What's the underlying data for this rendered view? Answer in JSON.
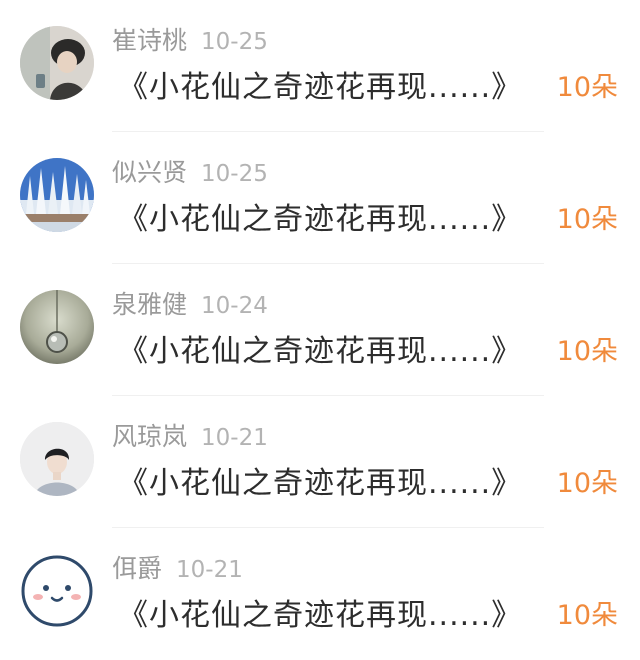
{
  "items": [
    {
      "user": "崔诗桃",
      "date": "10-25",
      "title": "《小花仙之奇迹花再现......》",
      "count": "10朵",
      "avatar": "avatar-girl-hat-icon"
    },
    {
      "user": "似兴贤",
      "date": "10-25",
      "title": "《小花仙之奇迹花再现......》",
      "count": "10朵",
      "avatar": "avatar-snow-trees-icon"
    },
    {
      "user": "泉雅健",
      "date": "10-24",
      "title": "《小花仙之奇迹花再现......》",
      "count": "10朵",
      "avatar": "avatar-water-drop-icon"
    },
    {
      "user": "风琼岚",
      "date": "10-21",
      "title": "《小花仙之奇迹花再现......》",
      "count": "10朵",
      "avatar": "avatar-boy-icon"
    },
    {
      "user": "佴爵",
      "date": "10-21",
      "title": "《小花仙之奇迹花再现......》",
      "count": "10朵",
      "avatar": "avatar-smiley-face-icon"
    }
  ],
  "colors": {
    "accent": "#f08a3c",
    "name": "#9a9a9a",
    "title": "#2d2d2d",
    "divider": "#f0f0f0"
  }
}
